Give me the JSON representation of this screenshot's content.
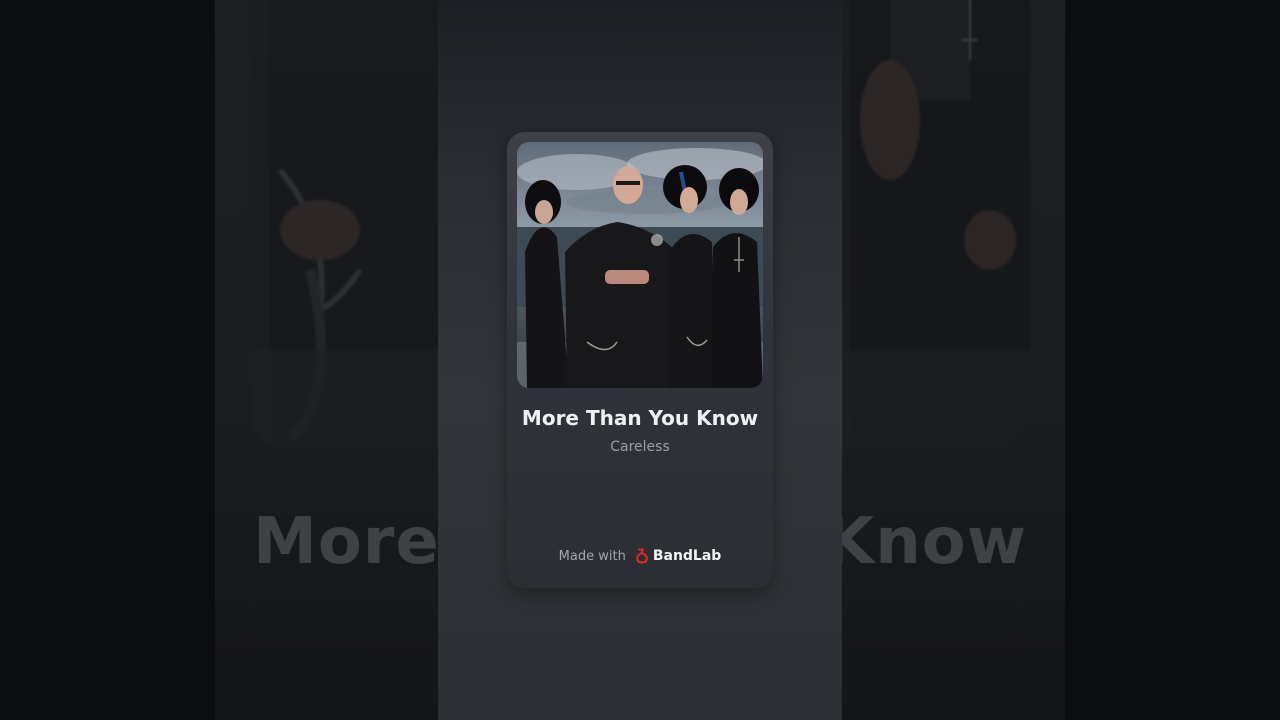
{
  "track": {
    "title": "More Than You Know",
    "artist": "Careless"
  },
  "branding": {
    "made_with_label": "Made with",
    "brand_name": "BandLab",
    "brand_color": "#e02a2a"
  },
  "backdrop": {
    "blurred_title": "More Than You Know"
  },
  "icons": {
    "brand_logo": "bandlab-logo-icon"
  }
}
